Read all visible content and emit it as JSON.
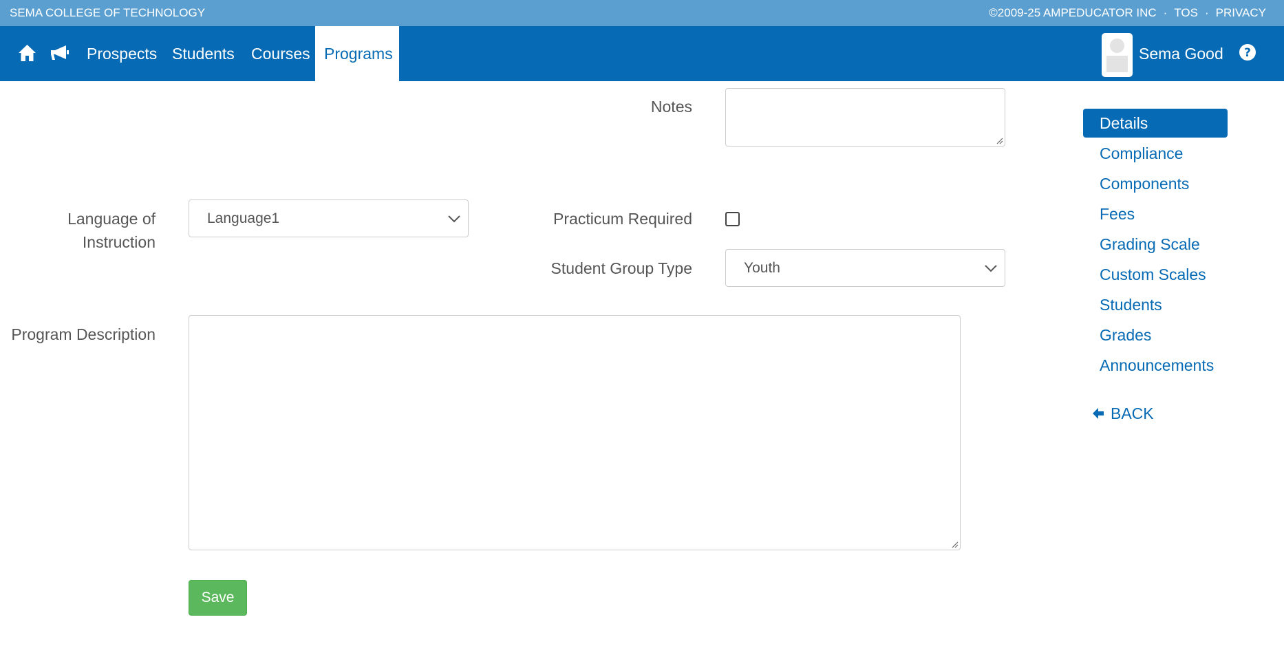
{
  "topbar": {
    "school": "SEMA COLLEGE OF TECHNOLOGY",
    "copyright": "©2009-25 AMPEDUCATOR INC",
    "sep1": "·",
    "tos": "TOS",
    "sep2": "·",
    "privacy": "PRIVACY"
  },
  "nav": {
    "items": [
      {
        "label": "Prospects"
      },
      {
        "label": "Students"
      },
      {
        "label": "Courses"
      },
      {
        "label": "Programs"
      }
    ],
    "active": "Programs",
    "icons": [
      "home-icon",
      "announcement-icon",
      "help-icon"
    ],
    "user_name": "Sema Good"
  },
  "form": {
    "notes_label": "Notes",
    "notes_value": "",
    "language_label_line1": "Language of",
    "language_label_line2": "Instruction",
    "language_value": "Language1",
    "practicum_label": "Practicum Required",
    "practicum_checked": false,
    "group_type_label": "Student Group Type",
    "group_type_value": "Youth",
    "description_label": "Program Description",
    "description_value": "",
    "save_label": "Save"
  },
  "side_menu": {
    "items": [
      {
        "label": "Details"
      },
      {
        "label": "Compliance"
      },
      {
        "label": "Components"
      },
      {
        "label": "Fees"
      },
      {
        "label": "Grading Scale"
      },
      {
        "label": "Custom Scales"
      },
      {
        "label": "Students"
      },
      {
        "label": "Grades"
      },
      {
        "label": "Announcements"
      }
    ],
    "active": "Details",
    "back_label": "BACK"
  },
  "colors": {
    "top_strip": "#5b9fd1",
    "nav_bar": "#066ab4",
    "link": "#066ab4",
    "save_button": "#5cb85c"
  }
}
